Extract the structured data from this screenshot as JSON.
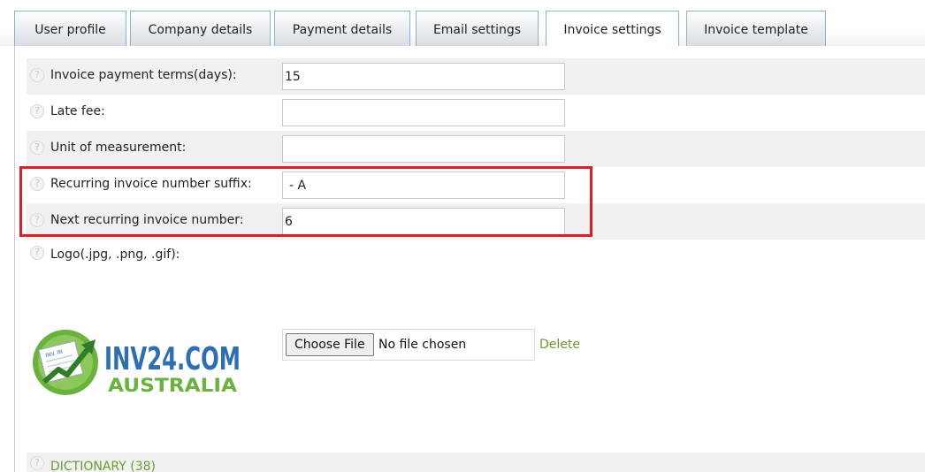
{
  "tabs": [
    {
      "label": "User profile"
    },
    {
      "label": "Company details"
    },
    {
      "label": "Payment details"
    },
    {
      "label": "Email settings"
    },
    {
      "label": "Invoice settings",
      "active": true
    },
    {
      "label": "Invoice template"
    }
  ],
  "form": {
    "payment_terms": {
      "label": "Invoice payment terms(days):",
      "value": "15"
    },
    "late_fee": {
      "label": "Late fee:",
      "value": ""
    },
    "unit": {
      "label": "Unit of measurement:",
      "value": ""
    },
    "suffix": {
      "label": "Recurring invoice number suffix:",
      "value": "- A"
    },
    "next_number": {
      "label": "Next recurring invoice number:",
      "value": "6"
    },
    "logo": {
      "label": "Logo(.jpg, .png, .gif):"
    }
  },
  "logo_image": {
    "line1": "INV24.COM",
    "line2": "AUSTRALIA",
    "doc_text": "INV. IN"
  },
  "file_input": {
    "button_label": "Choose File",
    "status": "No file chosen"
  },
  "delete_link": "Delete",
  "dictionary_link": "DICTIONARY (38)",
  "help_glyph": "?",
  "colors": {
    "highlight": "#d92027",
    "link_green": "#6a9b2f",
    "tab_border": "#8fb1c6",
    "row_alt": "#f1f1f1",
    "logo_blue": "#2c6fb3",
    "logo_green": "#6ab23e"
  }
}
